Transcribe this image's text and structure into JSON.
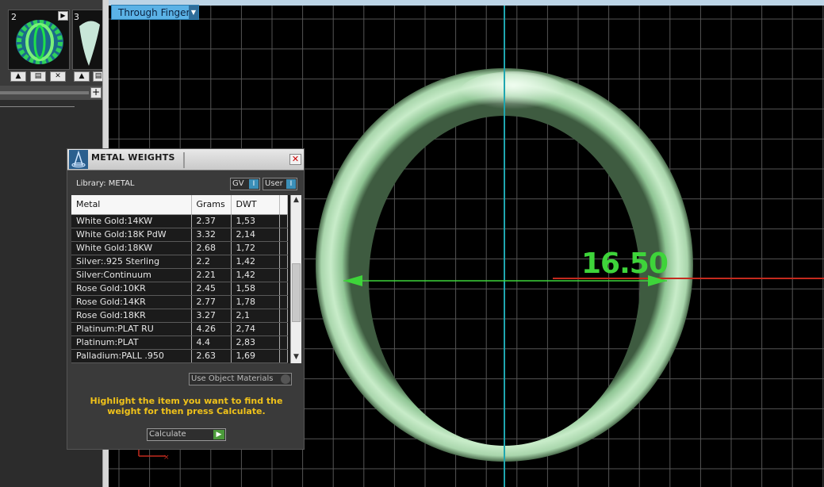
{
  "thumbnails": [
    {
      "number": "2"
    },
    {
      "number": "3"
    }
  ],
  "viewport": {
    "view_mode": "Through Finger",
    "measurement": "16.50",
    "colors": {
      "ring": "#cfeed1",
      "measure": "#3ed43a",
      "axis_x": "#c32a1e",
      "axis_y": "#1fa6b0",
      "grid": "#555555"
    }
  },
  "dialog": {
    "title": "METAL WEIGHTS",
    "library_label": "Library: METAL",
    "toggles": {
      "gv": "GV",
      "user": "User"
    },
    "columns": [
      "Metal",
      "Grams",
      "DWT"
    ],
    "rows": [
      {
        "metal": "White Gold:14KW",
        "grams": "2.37",
        "dwt": "1,53"
      },
      {
        "metal": "White Gold:18K PdW",
        "grams": "3.32",
        "dwt": "2,14"
      },
      {
        "metal": "White Gold:18KW",
        "grams": "2.68",
        "dwt": "1,72"
      },
      {
        "metal": "Silver:.925 Sterling",
        "grams": "2.2",
        "dwt": "1,42"
      },
      {
        "metal": "Silver:Continuum",
        "grams": "2.21",
        "dwt": "1,42"
      },
      {
        "metal": "Rose Gold:10KR",
        "grams": "2.45",
        "dwt": "1,58"
      },
      {
        "metal": "Rose Gold:14KR",
        "grams": "2.77",
        "dwt": "1,78"
      },
      {
        "metal": "Rose Gold:18KR",
        "grams": "3.27",
        "dwt": "2,1"
      },
      {
        "metal": "Platinum:PLAT RU",
        "grams": "4.26",
        "dwt": "2,74"
      },
      {
        "metal": "Platinum:PLAT",
        "grams": "4.4",
        "dwt": "2,83"
      },
      {
        "metal": "Palladium:PALL .950",
        "grams": "2.63",
        "dwt": "1,69"
      }
    ],
    "use_object_materials": "Use Object Materials",
    "instruction": "Highlight the item you want to find the weight for then press Calculate.",
    "calculate_label": "Calculate"
  }
}
